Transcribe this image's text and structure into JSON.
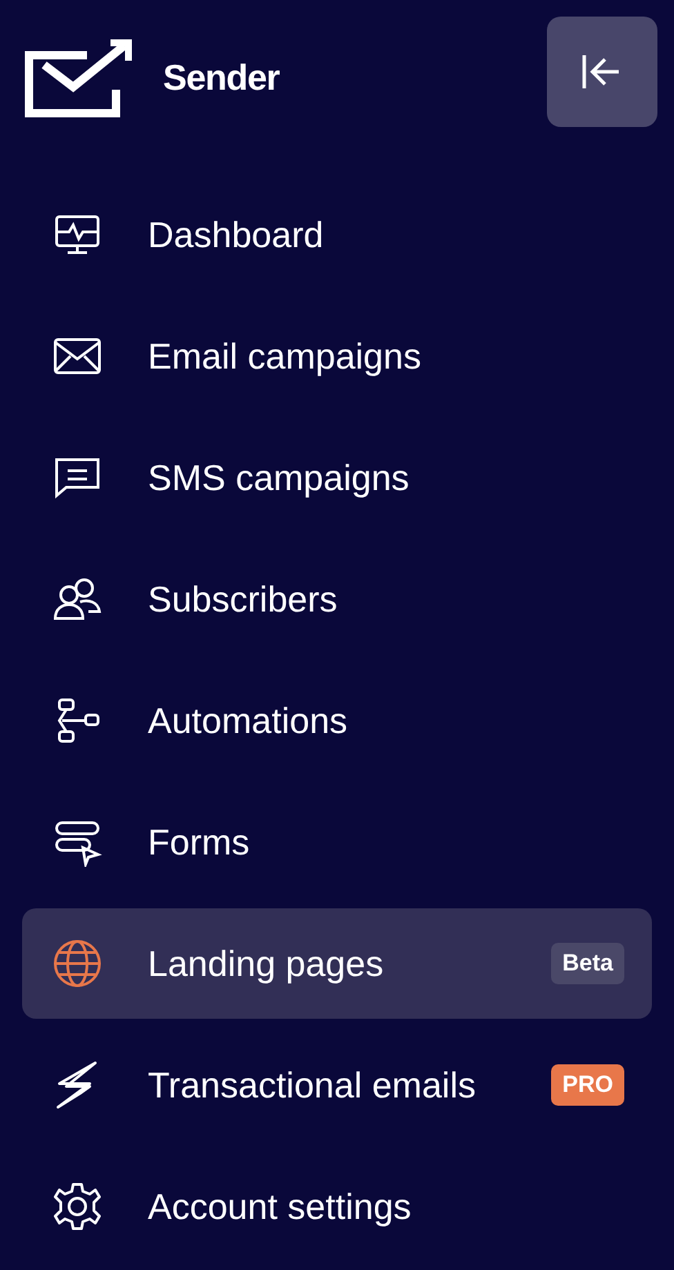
{
  "brand": {
    "name": "Sender"
  },
  "nav": [
    {
      "label": "Dashboard",
      "selected": false
    },
    {
      "label": "Email campaigns",
      "selected": false
    },
    {
      "label": "SMS campaigns",
      "selected": false
    },
    {
      "label": "Subscribers",
      "selected": false
    },
    {
      "label": "Automations",
      "selected": false
    },
    {
      "label": "Forms",
      "selected": false
    },
    {
      "label": "Landing pages",
      "selected": true,
      "badge": {
        "text": "Beta",
        "kind": "beta"
      }
    },
    {
      "label": "Transactional emails",
      "selected": false,
      "badge": {
        "text": "PRO",
        "kind": "pro"
      }
    },
    {
      "label": "Account settings",
      "selected": false
    }
  ]
}
